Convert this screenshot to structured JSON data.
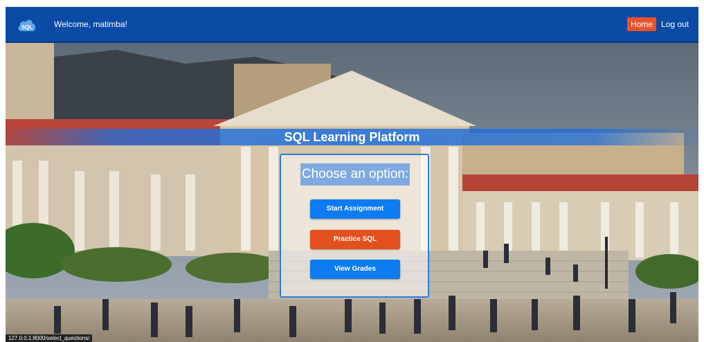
{
  "navbar": {
    "logo_text": "SQL",
    "welcome_text": "Welcome, matimba!",
    "home_label": "Home",
    "logout_label": "Log out"
  },
  "banner": {
    "title": "SQL Learning Platform"
  },
  "options_card": {
    "heading": "Choose an option:",
    "buttons": [
      {
        "label": "Start Assignment",
        "color": "#0d7cf0"
      },
      {
        "label": "Practice SQL",
        "color": "#e2501d"
      },
      {
        "label": "View Grades",
        "color": "#0d7cf0"
      }
    ]
  },
  "status_bar": {
    "url": "127.0.0.1:8000/select_questions/"
  },
  "colors": {
    "nav_background": "#0b4aa5",
    "accent_orange": "#e8532a",
    "accent_blue": "#0d7cf0"
  },
  "background_image": "campus-building-photo"
}
